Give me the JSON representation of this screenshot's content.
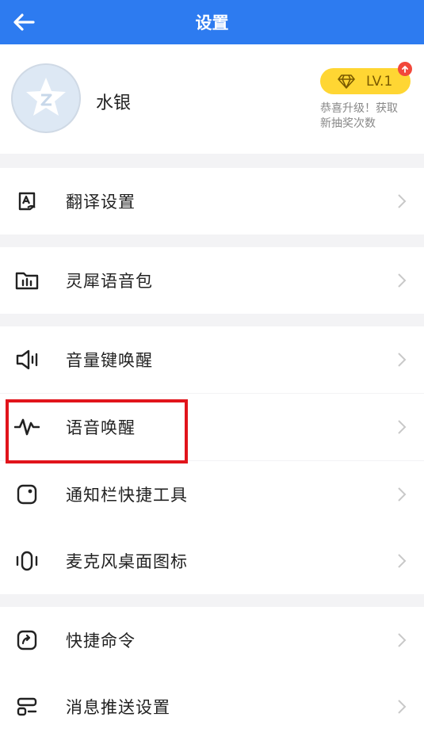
{
  "header": {
    "title": "设置",
    "back_icon": "arrow-left-icon"
  },
  "profile": {
    "username": "水银",
    "level": "LV.1",
    "upgrade_hint_line1": "恭喜升级！获取",
    "upgrade_hint_line2": "新抽奖次数"
  },
  "colors": {
    "header_bg": "#2d7bf0",
    "badge_bg": "#ffd633",
    "badge_dot": "#f2483b",
    "highlight_border": "#e1141b"
  },
  "settings": [
    {
      "label": "翻译设置",
      "icon": "translate-icon"
    },
    {
      "label": "灵犀语音包",
      "icon": "folder-audio-icon"
    },
    {
      "label": "音量键唤醒",
      "icon": "speaker-icon"
    },
    {
      "label": "语音唤醒",
      "icon": "waveform-icon",
      "highlighted": true
    },
    {
      "label": "通知栏快捷工具",
      "icon": "notification-icon"
    },
    {
      "label": "麦克风桌面图标",
      "icon": "microphone-icon"
    },
    {
      "label": "快捷命令",
      "icon": "shortcut-icon"
    },
    {
      "label": "消息推送设置",
      "icon": "push-icon"
    }
  ]
}
